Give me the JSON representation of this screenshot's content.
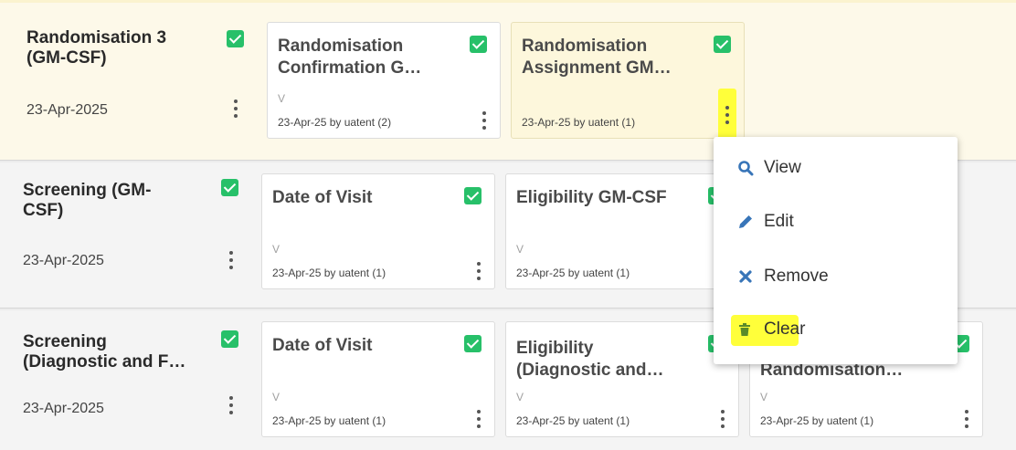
{
  "rows": [
    {
      "visit": {
        "title_line1": "Randomisation 3",
        "title_line2": "(GM-CSF)",
        "date": "23-Apr-2025"
      },
      "cards": [
        {
          "title_line1": "Randomisation",
          "title_line2": "Confirmation G…",
          "sig": "V",
          "meta": "23-Apr-25 by uatent (2)"
        },
        {
          "title_line1": "Randomisation",
          "title_line2": "Assignment GM…",
          "sig": "",
          "meta": "23-Apr-25 by uatent (1)"
        }
      ]
    },
    {
      "visit": {
        "title_line1": "Screening (GM-",
        "title_line2": "CSF)",
        "date": "23-Apr-2025"
      },
      "cards": [
        {
          "title_line1": "Date of Visit",
          "title_line2": "",
          "sig": "V",
          "meta": "23-Apr-25 by uatent (1)"
        },
        {
          "title_line1": "Eligibility GM-CSF",
          "title_line2": "",
          "sig": "V",
          "meta": "23-Apr-25 by uatent (1)"
        }
      ]
    },
    {
      "visit": {
        "title_line1": "Screening",
        "title_line2": "(Diagnostic and F…",
        "date": "23-Apr-2025"
      },
      "cards": [
        {
          "title_line1": "Date of Visit",
          "title_line2": "",
          "sig": "V",
          "meta": "23-Apr-25 by uatent (1)"
        },
        {
          "title_line1": "Eligibility",
          "title_line2": "(Diagnostic and…",
          "sig": "V",
          "meta": "23-Apr-25 by uatent (1)"
        },
        {
          "title_line1": "",
          "title_line2": "Randomisation…",
          "sig": "V",
          "meta": "23-Apr-25 by uatent (1)"
        }
      ]
    }
  ],
  "context_menu": {
    "items": [
      {
        "label": "View",
        "icon": "search-icon"
      },
      {
        "label": "Edit",
        "icon": "pencil-icon"
      },
      {
        "label": "Remove",
        "icon": "close-icon"
      },
      {
        "label": "Clear",
        "icon": "trash-icon"
      }
    ]
  },
  "colors": {
    "check_green": "#27c069",
    "menu_icon_blue": "#3875b8",
    "highlight_yellow": "#ffff3a",
    "selected_row": "#fdf9e9"
  }
}
